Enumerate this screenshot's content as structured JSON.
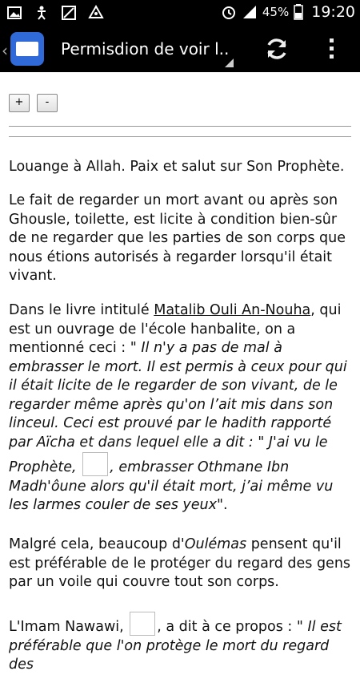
{
  "status": {
    "battery_pct": "45%",
    "time": "19:20"
  },
  "app": {
    "title": "Permisdion de voir l.."
  },
  "zoom": {
    "plus_label": "+",
    "minus_label": "-"
  },
  "article": {
    "p1": "Louange à Allah. Paix et salut sur Son Prophète.",
    "p2": "Le fait de regarder un mort avant ou après son Ghousle, toilette, est licite   à condition bien-sûr de ne regarder que les parties de son corps que nous étions autorisés à regarder  lorsqu'il était vivant.",
    "p3_a": "Dans le livre intitulé ",
    "p3_link": "Matalib Ouli An-Nouha",
    "p3_b": ", qui est un ouvrage de l'école hanbalite, on a mentionné ceci : \" ",
    "p3_italic": "Il n'y a pas de mal à embrasser le mort. Il est permis à ceux pour qui il était licite de le regarder de son vivant, de le regarder même après qu'on l’ait mis dans son linceul. Ceci est prouvé par le hadith rapporté par Aïcha et dans lequel elle a dit : \" J'ai vu le Prophète, ",
    "p3_italic2": ", embrasser Othmane Ibn Madh'ôune alors qu'il était mort, j’ai même vu  les larmes couler de ses yeux",
    "p3_end": "\".",
    "p4_a": "Malgré cela, beaucoup d'",
    "p4_italic": "Oulémas",
    "p4_b": " pensent qu'il est préférable de le  protéger du regard des gens par un voile qui couvre tout son corps.",
    "p5_a": "L'Imam Nawawi, ",
    "p5_b": ", a dit à ce propos : \" ",
    "p5_italic": "Il est préférable que l'on protège le mort du regard des"
  }
}
